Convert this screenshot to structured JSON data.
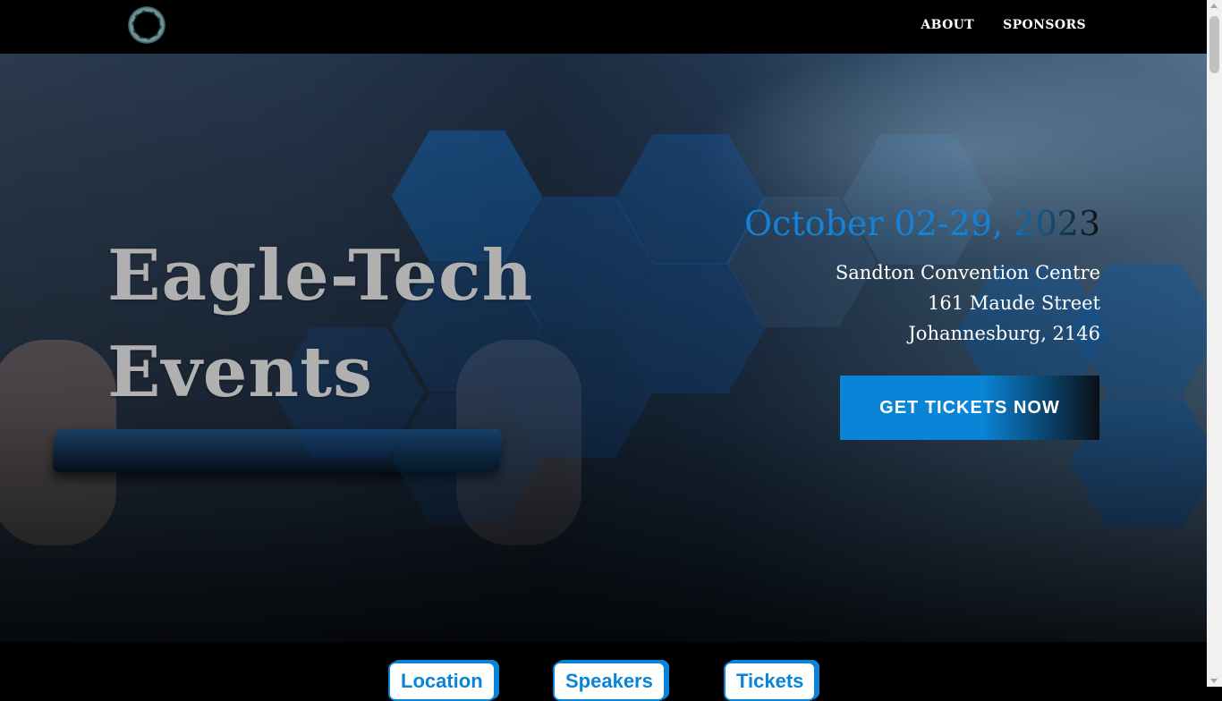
{
  "nav": {
    "logo": "logo-icon",
    "links": [
      "ABOUT",
      "SPONSORS"
    ]
  },
  "hero": {
    "title_line1": "Eagle-Tech",
    "title_line2": "Events",
    "date": "October 02-29, 2023",
    "venue": "Sandton Convention Centre",
    "street": "161 Maude Street",
    "city": "Johannesburg, 2146",
    "cta_label": "GET TICKETS NOW"
  },
  "tabs": [
    "Location",
    "Speakers",
    "Tickets"
  ],
  "colors": {
    "accent": "#0a84d6",
    "background": "#000000",
    "title": "#b0b0b0"
  }
}
